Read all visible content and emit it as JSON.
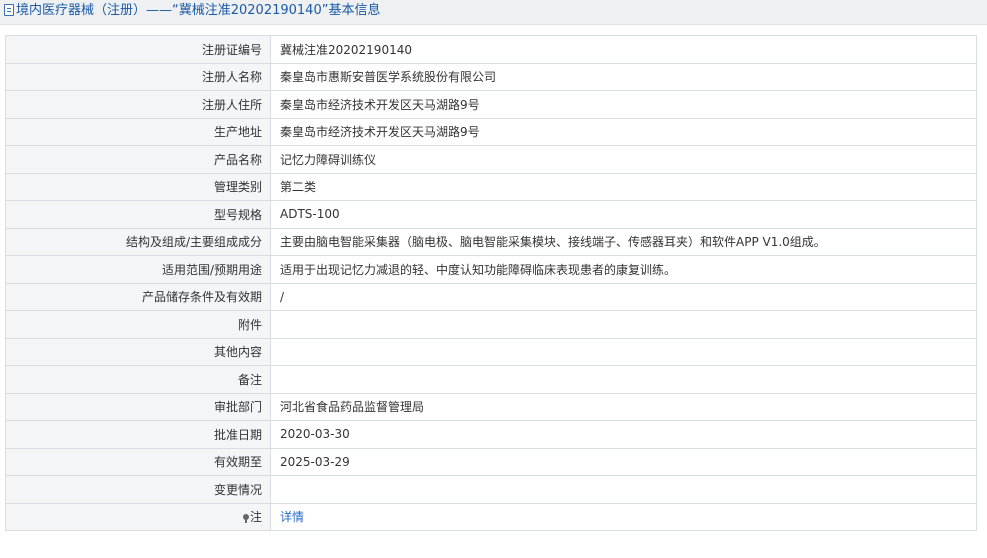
{
  "header": {
    "title": "境内医疗器械（注册）——“冀械注准20202190140”基本信息"
  },
  "rows": [
    {
      "label": "注册证编号",
      "value": "冀械注准20202190140"
    },
    {
      "label": "注册人名称",
      "value": "秦皇岛市惠斯安普医学系统股份有限公司"
    },
    {
      "label": "注册人住所",
      "value": "秦皇岛市经济技术开发区天马湖路9号"
    },
    {
      "label": "生产地址",
      "value": "秦皇岛市经济技术开发区天马湖路9号"
    },
    {
      "label": "产品名称",
      "value": "记忆力障碍训练仪"
    },
    {
      "label": "管理类别",
      "value": "第二类"
    },
    {
      "label": "型号规格",
      "value": "ADTS-100"
    },
    {
      "label": "结构及组成/主要组成成分",
      "value": "主要由脑电智能采集器（脑电极、脑电智能采集模块、接线端子、传感器耳夹）和软件APP V1.0组成。"
    },
    {
      "label": "适用范围/预期用途",
      "value": "适用于出现记忆力减退的轻、中度认知功能障碍临床表现患者的康复训练。"
    },
    {
      "label": "产品储存条件及有效期",
      "value": "/"
    },
    {
      "label": "附件",
      "value": ""
    },
    {
      "label": "其他内容",
      "value": ""
    },
    {
      "label": "备注",
      "value": ""
    },
    {
      "label": "审批部门",
      "value": "河北省食品药品监督管理局"
    },
    {
      "label": "批准日期",
      "value": "2020-03-30"
    },
    {
      "label": "有效期至",
      "value": "2025-03-29"
    },
    {
      "label": "变更情况",
      "value": ""
    }
  ],
  "note": {
    "label": "注",
    "link": "详情",
    "icon": "pin-icon"
  },
  "colors": {
    "title": "#1b5aa6",
    "link": "#2a6cc4",
    "label_bg": "#f4f5f7",
    "border": "#d8dde3"
  }
}
